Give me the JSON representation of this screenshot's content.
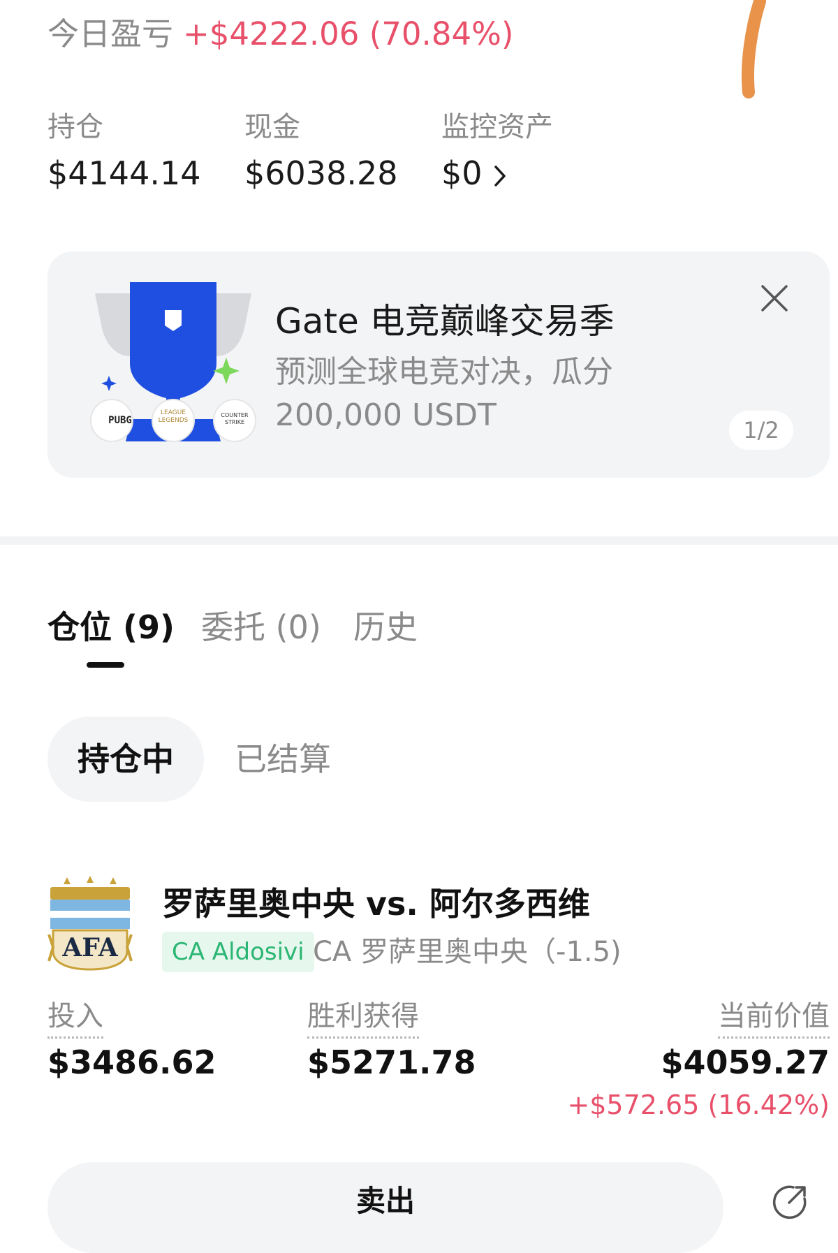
{
  "header": {
    "pnl_label": "今日盈亏",
    "pnl_value": "+$4222.06 (70.84%)"
  },
  "stats": [
    {
      "label": "持仓",
      "value": "$4144.14"
    },
    {
      "label": "现金",
      "value": "$6038.28"
    },
    {
      "label": "监控资产",
      "value": "$0"
    }
  ],
  "banner": {
    "title": "Gate 电竞巅峰交易季",
    "subtitle": "预测全球电竞对决，瓜分 200,000 USDT",
    "page_indicator": "1/2",
    "art_badges": [
      "PUBG",
      "LEAGUE LEGENDS",
      "COUNTER STRIKE"
    ]
  },
  "tabs": [
    {
      "label": "仓位 (9)",
      "active": true
    },
    {
      "label": "委托 (0)",
      "active": false
    },
    {
      "label": "历史",
      "active": false
    }
  ],
  "segments": [
    {
      "label": "持仓中",
      "active": true
    },
    {
      "label": "已结算",
      "active": false
    }
  ],
  "position": {
    "logo_text": "AFA",
    "match": "罗萨里奥中央 vs. 阿尔多西维",
    "outcome_tag": "CA Aldosivi",
    "outcome_desc": "CA 罗萨里奥中央（-1.5)",
    "invested_label": "投入",
    "invested_value": "$3486.62",
    "payout_label": "胜利获得",
    "payout_value": "$5271.78",
    "current_label": "当前价值",
    "current_value": "$4059.27",
    "current_pnl": "+$572.65 (16.42%)",
    "sell_label": "卖出"
  },
  "colors": {
    "positive": "#e8506a",
    "tag_green": "#2bb673",
    "muted": "#8a8a8a",
    "brand_blue": "#1f4fe0"
  },
  "icons": [
    "chevron-right-icon",
    "close-icon",
    "share-icon",
    "trophy-illustration"
  ]
}
